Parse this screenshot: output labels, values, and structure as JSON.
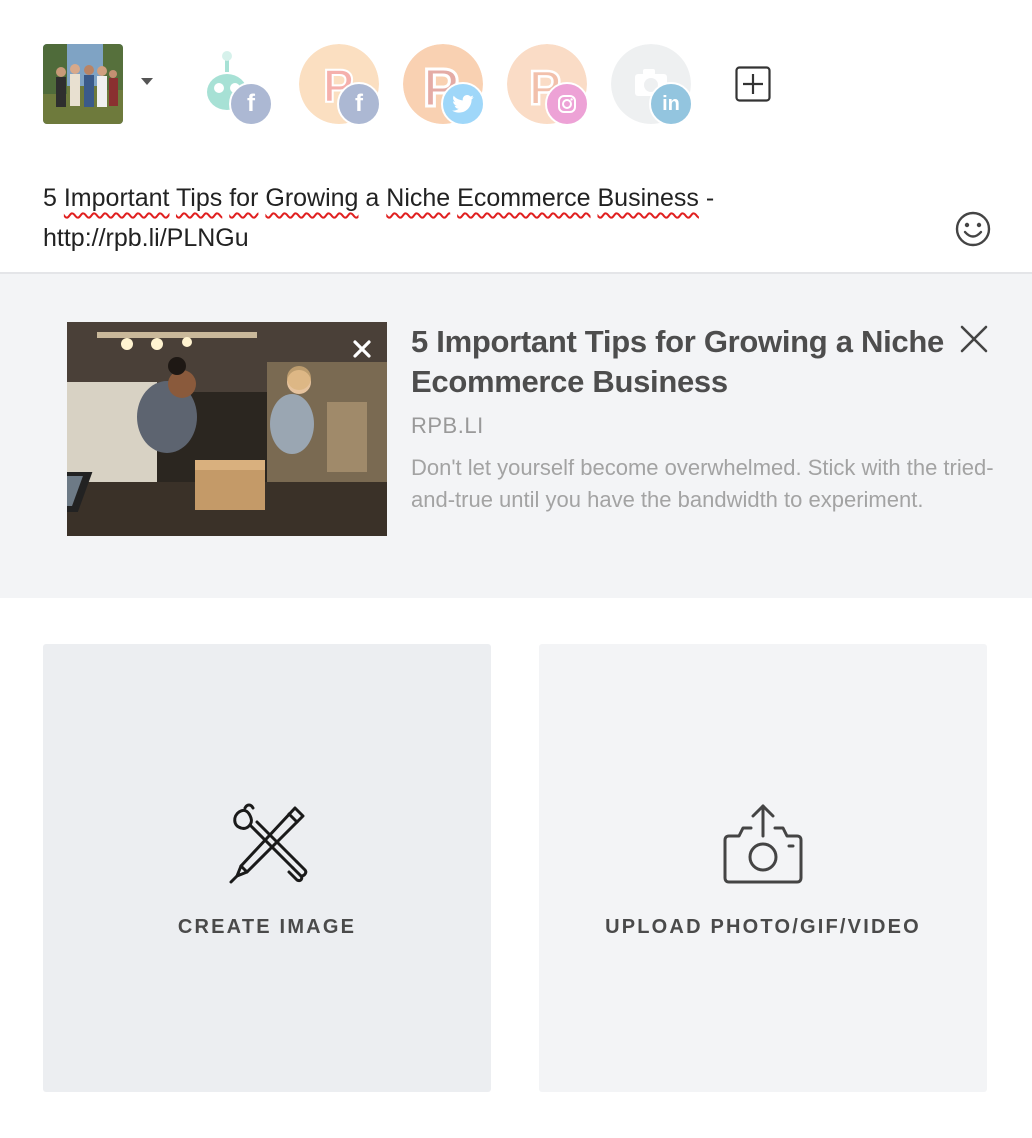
{
  "accounts": {
    "user_avatar_alt": "group photo",
    "profiles": [
      {
        "name": "bot",
        "network": "facebook",
        "color": "#3bb0a0",
        "network_color": "#3b5998"
      },
      {
        "name": "P",
        "network": "facebook",
        "color": "#f4a35a",
        "network_color": "#3b5998"
      },
      {
        "name": "P",
        "network": "twitter",
        "color": "#ef7e3d",
        "network_color": "#1da1f2"
      },
      {
        "name": "P",
        "network": "instagram",
        "color": "#f3a773",
        "network_color": "#d6249f"
      },
      {
        "name": "camera",
        "network": "linkedin",
        "color": "#dfe1e4",
        "network_color": "#0077b5"
      }
    ],
    "network_glyphs": {
      "facebook": "f",
      "linkedin": "in"
    }
  },
  "composer": {
    "text_line1_words": [
      "5",
      "Important",
      "Tips",
      "for",
      "Growing",
      "a",
      "Niche",
      "Ecommerce",
      "Business"
    ],
    "text_line1_suffix": " -",
    "text_line2": "http://rpb.li/PLNGu"
  },
  "link_preview": {
    "title": "5 Important Tips for Growing a Niche Ecommerce Business",
    "domain": "RPB.LI",
    "description": "Don't let yourself become overwhelmed. Stick with the tried-and-true until you have the bandwidth to experiment."
  },
  "media_options": {
    "create_label": "CREATE IMAGE",
    "upload_label": "UPLOAD PHOTO/GIF/VIDEO"
  },
  "colors": {
    "text": "#222222",
    "preview_bg": "#f3f4f6",
    "tile_create_bg": "#eceef1",
    "tile_upload_bg": "#f3f4f6",
    "spellcheck": "#e02020"
  }
}
